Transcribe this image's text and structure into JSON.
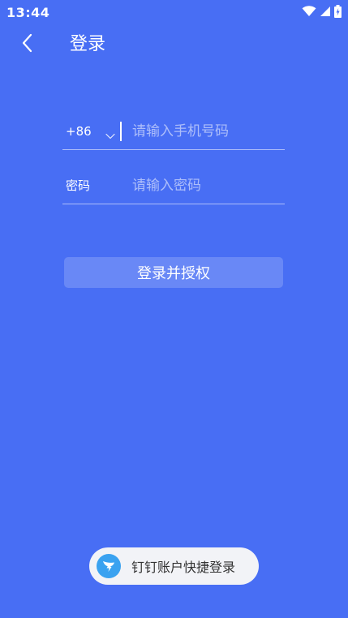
{
  "status_bar": {
    "time": "13:44",
    "icons": [
      "wifi-icon",
      "cellular-signal-icon",
      "battery-charging-icon"
    ]
  },
  "nav": {
    "back_icon": "chevron-left-icon",
    "title": "登录"
  },
  "form": {
    "country_code": "+86",
    "country_chevron_icon": "chevron-down-icon",
    "phone_placeholder": "请输入手机号码",
    "phone_value": "",
    "password_label": "密码",
    "password_placeholder": "请输入密码",
    "password_value": ""
  },
  "actions": {
    "submit_label": "登录并授权",
    "dingtalk_label": "钉钉账户快捷登录",
    "dingtalk_icon": "dingtalk-logo-icon"
  },
  "colors": {
    "background": "#486ef4",
    "dingtalk_blue": "#3aa2f0"
  }
}
